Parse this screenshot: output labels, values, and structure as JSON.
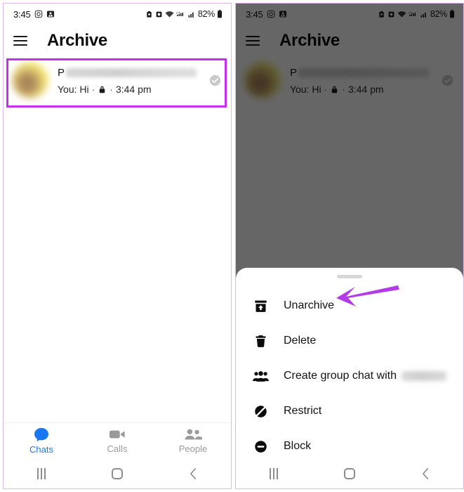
{
  "status_bar": {
    "time": "3:45",
    "battery_percent": "82%",
    "left_icons": [
      "instagram-icon",
      "photos-icon"
    ],
    "right_icons": [
      "alarm-icon",
      "alarm-clock-icon",
      "wifi-icon",
      "lte-signal-icon",
      "cellular-signal-icon"
    ]
  },
  "app_bar": {
    "menu_icon": "hamburger-menu-icon",
    "title": "Archive"
  },
  "chat_row": {
    "name_visible": "P",
    "name_redacted": true,
    "preview_prefix": "You: Hi",
    "separator": "·",
    "lock_icon": "lock-icon",
    "time": "3:44 pm",
    "status_icon": "delivered-check-icon"
  },
  "bottom_nav": {
    "items": [
      {
        "label": "Chats",
        "icon": "chat-bubble-icon",
        "active": true
      },
      {
        "label": "Calls",
        "icon": "video-camera-icon",
        "active": false
      },
      {
        "label": "People",
        "icon": "people-icon",
        "active": false
      }
    ],
    "active_color": "#1877f2",
    "inactive_color": "#9a9a9a"
  },
  "system_nav": {
    "recents": "recents-icon",
    "home": "home-icon",
    "back": "back-icon"
  },
  "bottom_sheet": {
    "handle": "drag-handle",
    "items": [
      {
        "label": "Unarchive",
        "icon": "unarchive-icon",
        "redacted_suffix": false
      },
      {
        "label": "Delete",
        "icon": "trash-icon",
        "redacted_suffix": false
      },
      {
        "label": "Create group chat with",
        "icon": "group-people-icon",
        "redacted_suffix": true
      },
      {
        "label": "Restrict",
        "icon": "restrict-icon",
        "redacted_suffix": false
      },
      {
        "label": "Block",
        "icon": "block-icon",
        "redacted_suffix": false
      }
    ]
  },
  "annotations": {
    "highlight_color": "#c62ef0",
    "arrow_color": "#b33ce8",
    "arrow_points_to": "Unarchive",
    "highlight_target": "chat-row"
  },
  "scrim": {
    "color": "#000000",
    "opacity": "0.6"
  }
}
